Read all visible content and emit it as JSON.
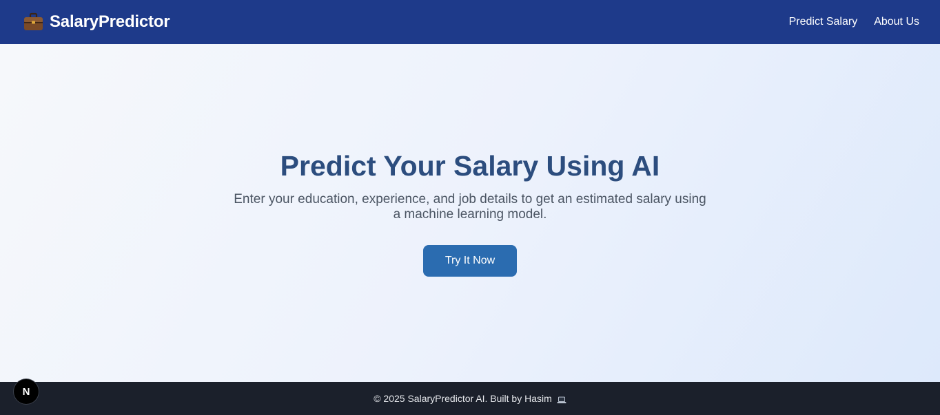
{
  "navbar": {
    "brand_name": "SalaryPredictor",
    "brand_icon": "briefcase-icon",
    "links": [
      {
        "label": "Predict Salary"
      },
      {
        "label": "About Us"
      }
    ]
  },
  "hero": {
    "title": "Predict Your Salary Using AI",
    "subtitle": "Enter your education, experience, and job details to get an estimated salary using a machine learning model.",
    "cta_label": "Try It Now"
  },
  "footer": {
    "text": "© 2025 SalaryPredictor AI. Built by Hasim",
    "icon": "laptop-icon"
  },
  "dev_badge": {
    "label": "N"
  },
  "colors": {
    "navbar_bg": "#1e3a8a",
    "title": "#2c4d7e",
    "cta_bg": "#2b6cb0",
    "footer_bg": "#1b202b"
  }
}
